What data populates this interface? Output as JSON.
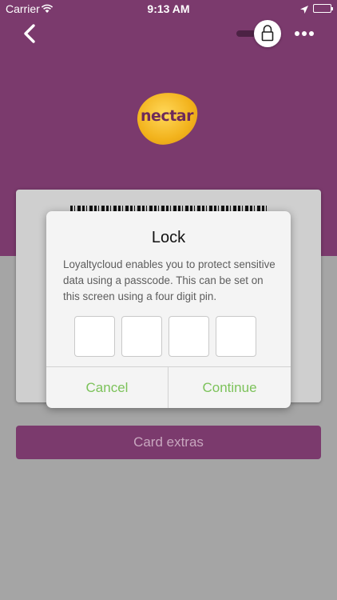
{
  "status_bar": {
    "carrier": "Carrier",
    "time": "9:13 AM",
    "wifi_icon": "wifi-icon",
    "location_icon": "location-arrow-icon",
    "battery_icon": "battery-icon"
  },
  "nav": {
    "back_icon": "chevron-left-icon",
    "lock_icon": "lock-icon",
    "more_icon": "ellipsis-icon"
  },
  "card": {
    "logo_text": "nectar",
    "extras_label": "Card extras"
  },
  "dialog": {
    "title": "Lock",
    "message": "Loyaltycloud enables you to protect sensitive data using a passcode. This can be set on this screen using a four digit pin.",
    "pin_digits": [
      "",
      "",
      "",
      ""
    ],
    "cancel_label": "Cancel",
    "continue_label": "Continue"
  },
  "colors": {
    "brand": "#7b3a6d",
    "accent_green": "#7cc25a",
    "overlay_gray": "#a5a5a5"
  }
}
